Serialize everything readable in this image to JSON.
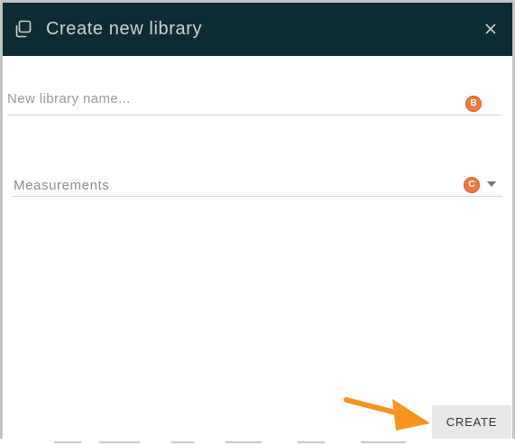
{
  "dialog": {
    "title": "Create new library",
    "icon": "library-stack-icon",
    "close_icon": "close-icon"
  },
  "form": {
    "name_field": {
      "placeholder": "New library name...",
      "value": "",
      "badge": "B"
    },
    "measurements_field": {
      "value": "Measurements",
      "badge": "C",
      "icon": "dropdown-arrow-icon"
    }
  },
  "actions": {
    "create_label": "CREATE",
    "pointer_icon": "orange-arrow-pointer-icon"
  },
  "colors": {
    "header_bg": "#0d2b33",
    "header_text": "#c9d3d6",
    "badge": "#ef7a3c",
    "pointer": "#f7941d",
    "button_bg": "#e8e8e8"
  }
}
